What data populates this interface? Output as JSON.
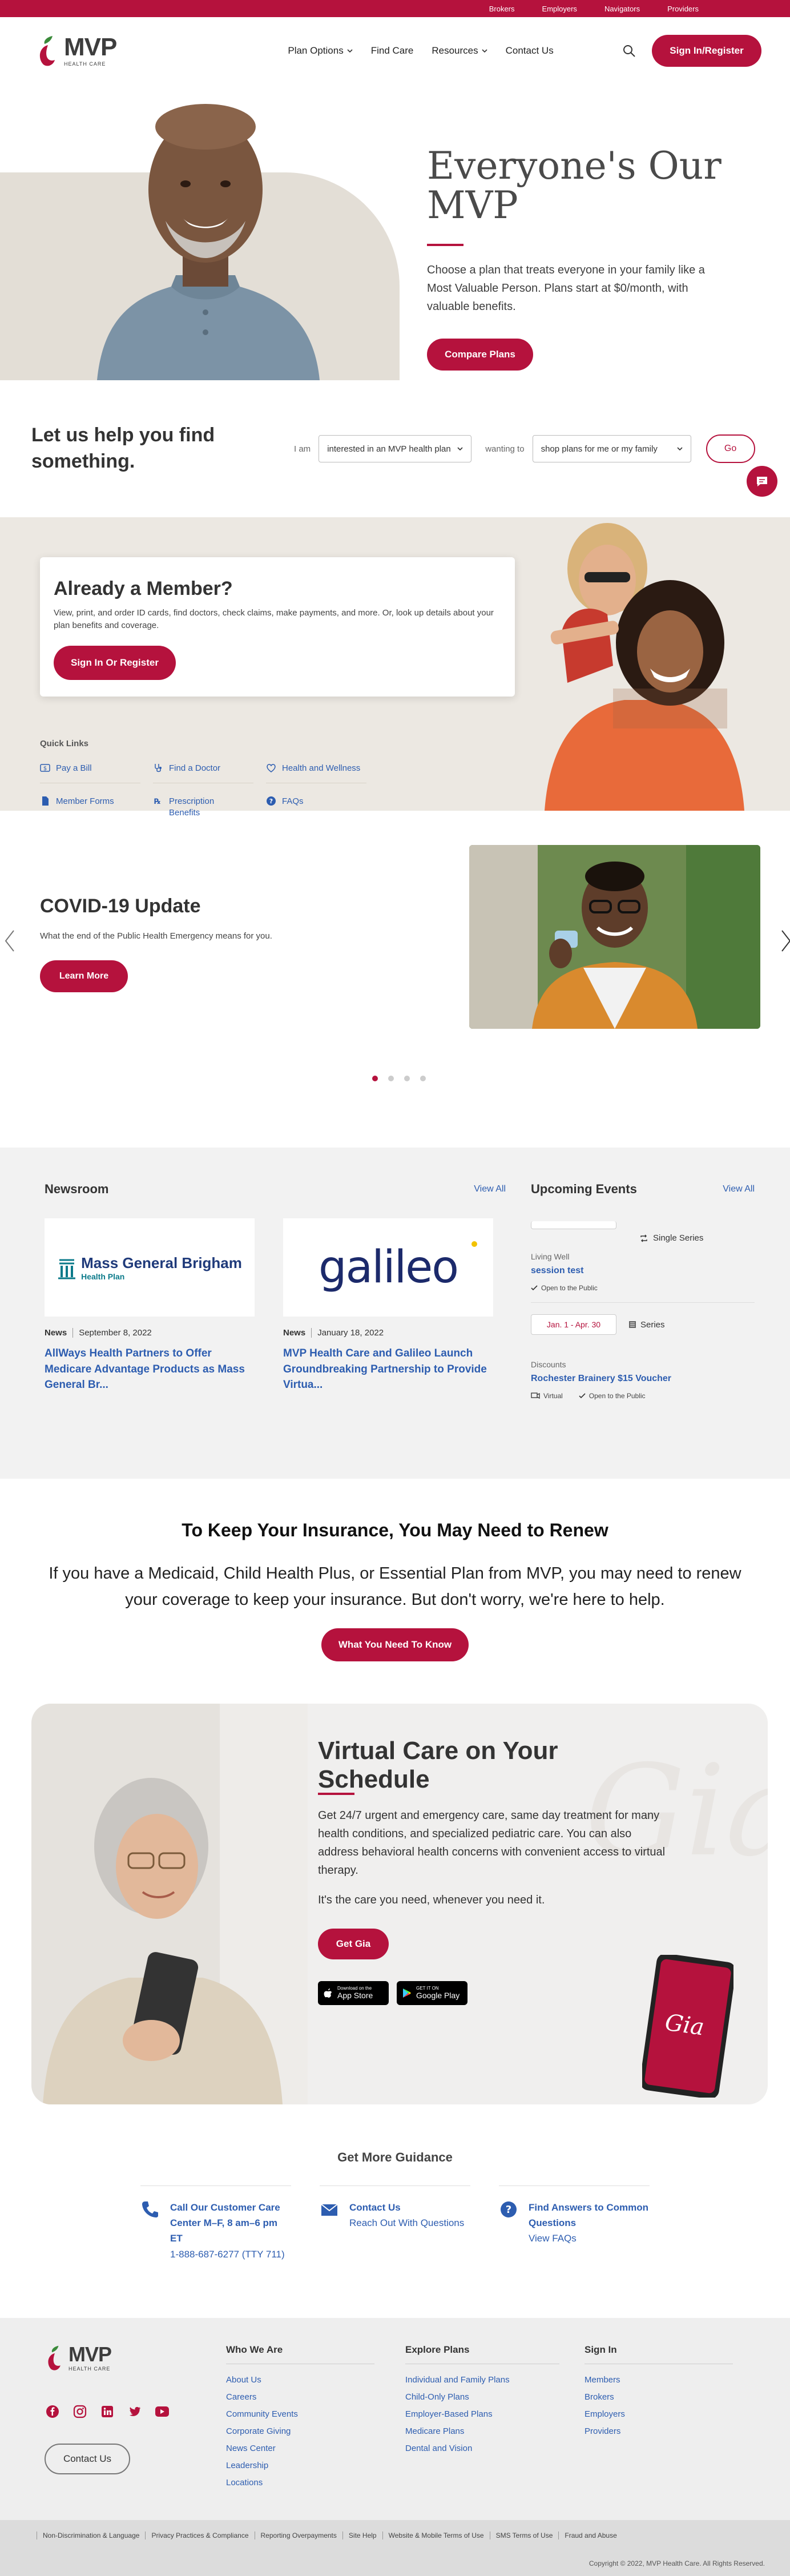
{
  "utility_nav": [
    "Brokers",
    "Employers",
    "Navigators",
    "Providers"
  ],
  "header": {
    "logo_text": "MVP",
    "logo_sub": "HEALTH CARE",
    "nav": [
      {
        "label": "Plan Options",
        "dropdown": true
      },
      {
        "label": "Find Care",
        "dropdown": false
      },
      {
        "label": "Resources",
        "dropdown": true
      },
      {
        "label": "Contact Us",
        "dropdown": false
      }
    ],
    "signin_label": "Sign In/Register"
  },
  "hero": {
    "title": "Everyone's Our MVP",
    "description": "Choose a plan that treats everyone in your family like a Most Valuable Person. Plans start at $0/month, with valuable benefits.",
    "button": "Compare Plans"
  },
  "help": {
    "title": "Let us help you find something.",
    "i_am_label": "I am",
    "i_am_value": "interested in an MVP health plan",
    "wanting_label": "wanting to",
    "wanting_value": "shop plans for me or my family",
    "go_label": "Go"
  },
  "member": {
    "title": "Already a Member?",
    "description": "View, print, and order ID cards, find doctors, check claims, make payments, and more. Or, look up details about your plan benefits and coverage.",
    "button": "Sign In Or Register",
    "quick_links_title": "Quick Links",
    "quick_links": [
      {
        "label": "Pay a Bill",
        "icon": "dollar-icon"
      },
      {
        "label": "Find a Doctor",
        "icon": "stethoscope-icon"
      },
      {
        "label": "Health and Wellness",
        "icon": "heart-icon"
      },
      {
        "label": "Member Forms",
        "icon": "document-icon"
      },
      {
        "label": "Prescription Benefits",
        "icon": "prescription-icon"
      },
      {
        "label": "FAQs",
        "icon": "question-icon"
      }
    ]
  },
  "covid": {
    "title": "COVID-19 Update",
    "description": "What the end of the Public Health Emergency means for you.",
    "button": "Learn More"
  },
  "newsroom": {
    "title": "Newsroom",
    "view_all": "View All",
    "articles": [
      {
        "logo_text": "Mass General Brigham",
        "logo_sub": "Health Plan",
        "category": "News",
        "date": "September 8, 2022",
        "headline": "AllWays Health Partners to Offer Medicare Advantage Products as Mass General Br..."
      },
      {
        "logo_text": "galileo",
        "category": "News",
        "date": "January 18, 2022",
        "headline": "MVP Health Care and Galileo Launch Groundbreaking Partnership to Provide Virtua..."
      }
    ]
  },
  "events": {
    "title": "Upcoming Events",
    "view_all": "View All",
    "items": [
      {
        "chip": "",
        "series": "Single Series",
        "category": "Living Well",
        "title": "session test",
        "tags": [
          "Open to the Public"
        ]
      },
      {
        "chip": "Jan. 1 - Apr. 30",
        "series": "Series",
        "category": "Discounts",
        "title": "Rochester Brainery $15 Voucher",
        "tags": [
          "Virtual",
          "Open to the Public"
        ]
      }
    ]
  },
  "renew": {
    "title": "To Keep Your Insurance, You May Need to Renew",
    "text": "If you have a Medicaid, Child Health Plus, or Essential Plan from MVP, you may need to renew your coverage to keep your insurance. But don't worry, we're here to help.",
    "button": "What You Need To Know"
  },
  "virtual_care": {
    "title": "Virtual Care on Your Schedule",
    "text1": "Get 24/7 urgent and emergency care, same day treatment for many health conditions, and specialized pediatric care. You can also address behavioral health concerns with convenient access to virtual therapy.",
    "text2": "It's the care you need, whenever you need it.",
    "button": "Get Gia",
    "app_store": {
      "small": "Download on the",
      "large": "App Store"
    },
    "google_play": {
      "small": "GET IT ON",
      "large": "Google Play"
    },
    "phone_logo": "Gia",
    "watermark": "Gia"
  },
  "guidance": {
    "title": "Get More Guidance",
    "items": [
      {
        "icon": "phone-icon",
        "title": "Call Our Customer Care Center M–F, 8 am–6 pm ET",
        "sub": "1-888-687-6277 (TTY 711)"
      },
      {
        "icon": "mail-icon",
        "title": "Contact Us",
        "sub": "Reach Out With Questions"
      },
      {
        "icon": "question-icon",
        "title": "Find Answers to Common Questions",
        "sub": "View FAQs"
      }
    ]
  },
  "footer": {
    "contact_button": "Contact Us",
    "social": [
      "facebook-icon",
      "instagram-icon",
      "linkedin-icon",
      "twitter-icon",
      "youtube-icon"
    ],
    "columns": [
      {
        "title": "Who We Are",
        "links": [
          "About Us",
          "Careers",
          "Community Events",
          "Corporate Giving",
          "News Center",
          "Leadership",
          "Locations"
        ]
      },
      {
        "title": "Explore Plans",
        "links": [
          "Individual and Family Plans",
          "Child-Only Plans",
          "Employer-Based Plans",
          "Medicare Plans",
          "Dental and Vision"
        ]
      },
      {
        "title": "Sign In",
        "links": [
          "Members",
          "Brokers",
          "Employers",
          "Providers"
        ]
      }
    ],
    "legal_links": [
      "Non-Discrimination & Language",
      "Privacy Practices & Compliance",
      "Reporting Overpayments",
      "Site Help",
      "Website & Mobile Terms of Use",
      "SMS Terms of Use",
      "Fraud and Abuse"
    ],
    "copyright": "Copyright © 2022, MVP Health Care. All Rights Reserved."
  },
  "colors": {
    "brand": "#b5123d",
    "link": "#2d5db0",
    "beige": "#e3ded6"
  }
}
